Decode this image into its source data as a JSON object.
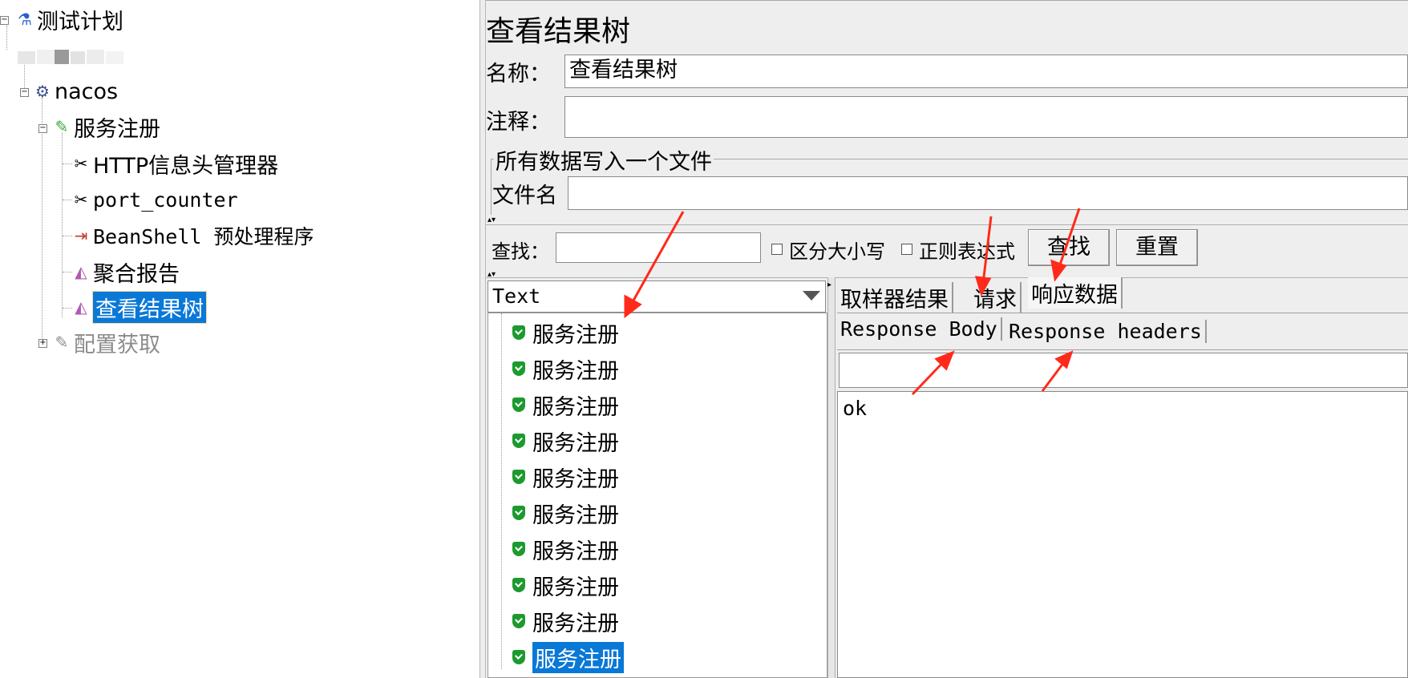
{
  "tree": {
    "root": "测试计划",
    "group": "nacos",
    "controller1": "服务注册",
    "items": [
      "HTTP信息头管理器",
      "port_counter",
      "BeanShell 预处理程序",
      "聚合报告",
      "查看结果树"
    ],
    "controller2": "配置获取"
  },
  "panel": {
    "title": "查看结果树",
    "name_label": "名称：",
    "name_value": "查看结果树",
    "comment_label": "注释：",
    "comment_value": "",
    "file_group_label": "所有数据写入一个文件",
    "filename_label": "文件名",
    "filename_value": ""
  },
  "search": {
    "label": "查找：",
    "value": "",
    "case_label": "区分大小写",
    "regex_label": "正则表达式",
    "find_button": "查找",
    "reset_button": "重置"
  },
  "renderer": {
    "selected": "Text"
  },
  "results": [
    "服务注册",
    "服务注册",
    "服务注册",
    "服务注册",
    "服务注册",
    "服务注册",
    "服务注册",
    "服务注册",
    "服务注册",
    "服务注册"
  ],
  "tabs": [
    "取样器结果",
    "请求",
    "响应数据"
  ],
  "subtabs": [
    "Response Body",
    "Response headers"
  ],
  "response": {
    "search_value": "",
    "body": "ok"
  },
  "colors": {
    "selection": "#0a78d7",
    "annotation": "#ff2a1a"
  }
}
